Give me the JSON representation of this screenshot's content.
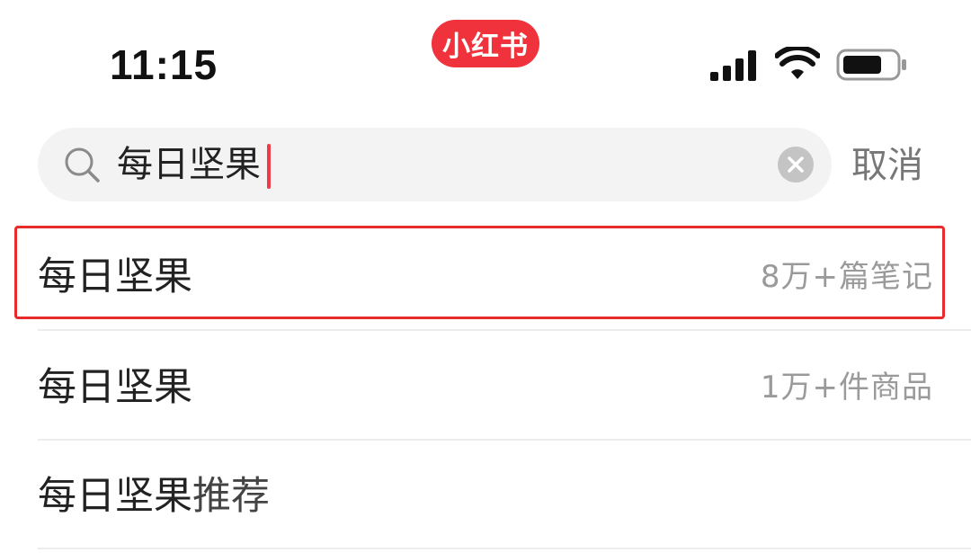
{
  "status_bar": {
    "time": "11:15",
    "app_badge": "小红书",
    "icons": [
      "signal-icon",
      "wifi-icon",
      "battery-icon"
    ]
  },
  "search": {
    "value": "每日坚果",
    "cancel_label": "取消",
    "icons": [
      "search-icon",
      "clear-icon"
    ]
  },
  "suggestions": [
    {
      "term": "每日坚果",
      "suffix": "",
      "meta": "8万+篇笔记",
      "highlighted": true
    },
    {
      "term": "每日坚果",
      "suffix": "",
      "meta": "1万+件商品",
      "highlighted": false
    },
    {
      "term": "每日坚果",
      "suffix": "推荐",
      "meta": "",
      "highlighted": false
    }
  ],
  "colors": {
    "brand": "#f0323c",
    "caret": "#f23a47",
    "highlight_border": "#e82b2b",
    "search_bg": "#f3f3f3",
    "meta_text": "#9a9a9a"
  }
}
